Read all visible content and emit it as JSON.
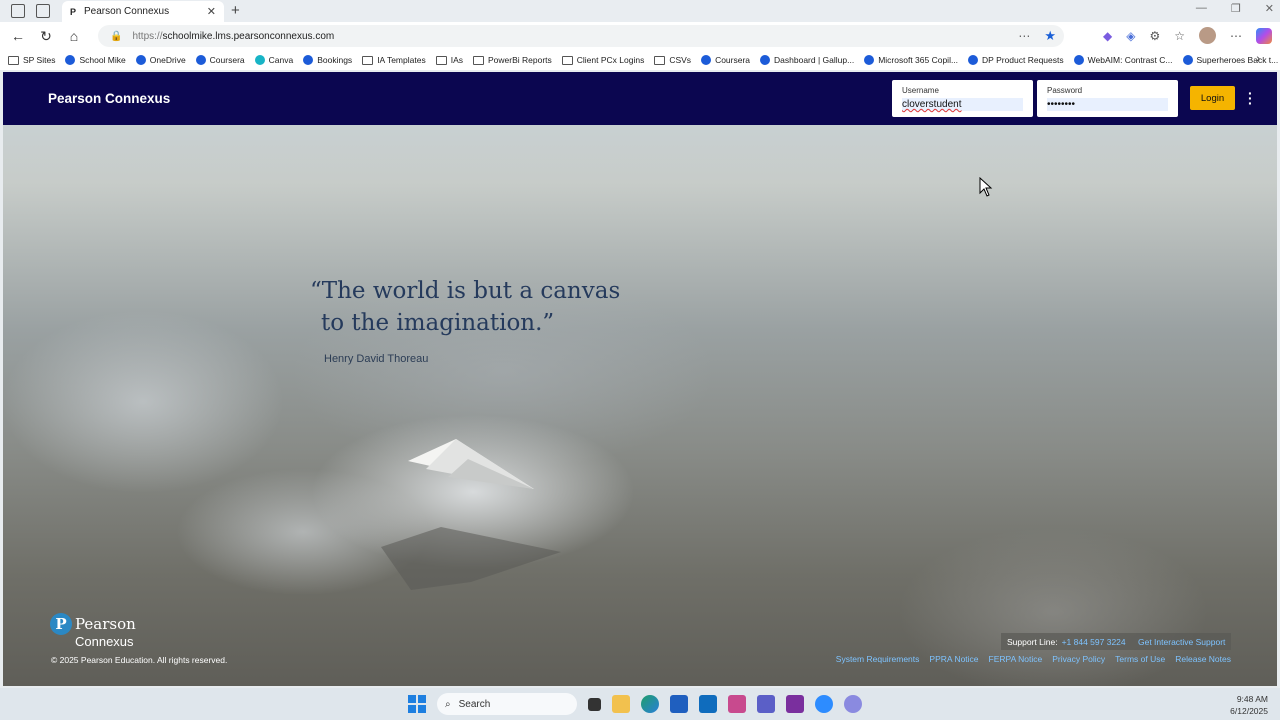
{
  "browser": {
    "tab_title": "Pearson Connexus",
    "url_protocol": "https://",
    "url_host": "schoolmike.lms.pearsonconnexus.com",
    "bookmarks": [
      {
        "label": "SP Sites",
        "icon": "folder-icon"
      },
      {
        "label": "School Mike",
        "icon": "pearson-icon"
      },
      {
        "label": "OneDrive",
        "icon": "cloud-icon"
      },
      {
        "label": "Coursera",
        "icon": "coursera-icon"
      },
      {
        "label": "Canva",
        "icon": "canva-icon"
      },
      {
        "label": "Bookings",
        "icon": "bookings-icon"
      },
      {
        "label": "IA Templates",
        "icon": "folder-icon"
      },
      {
        "label": "IAs",
        "icon": "folder-icon"
      },
      {
        "label": "PowerBi Reports",
        "icon": "folder-icon"
      },
      {
        "label": "Client PCx Logins",
        "icon": "folder-icon"
      },
      {
        "label": "CSVs",
        "icon": "folder-icon"
      },
      {
        "label": "Coursera",
        "icon": "coursera-icon"
      },
      {
        "label": "Dashboard | Gallup...",
        "icon": "gallup-icon"
      },
      {
        "label": "Microsoft 365 Copil...",
        "icon": "copilot-icon"
      },
      {
        "label": "DP Product Requests",
        "icon": "jira-icon"
      },
      {
        "label": "WebAIM: Contrast C...",
        "icon": "webaim-icon"
      },
      {
        "label": "Superheroes Back t...",
        "icon": "powerpoint-icon"
      }
    ]
  },
  "header": {
    "brand": "Pearson Connexus",
    "username_label": "Username",
    "username_value": "cloverstudent",
    "password_label": "Password",
    "password_value": "••••••••",
    "login_label": "Login"
  },
  "hero": {
    "quote_line": "“The world is but a canvas to the imagination.”",
    "author": "Henry David Thoreau"
  },
  "footer": {
    "logo_pearson": "Pearson",
    "logo_connexus": "Connexus",
    "copyright": "© 2025 Pearson Education. All rights reserved.",
    "support_label": "Support Line:",
    "support_phone": "+1 844 597 3224",
    "interactive_support": "Get Interactive Support",
    "links": [
      "System Requirements",
      "PPRA Notice",
      "FERPA Notice",
      "Privacy Policy",
      "Terms of Use",
      "Release Notes"
    ]
  },
  "taskbar": {
    "search_placeholder": "Search",
    "time": "9:48 AM",
    "date": "6/12/2025"
  },
  "colors": {
    "header_bg": "#0b0650",
    "login_button": "#f5b400",
    "link": "#7ec3ff",
    "quote_text": "#253a5c"
  }
}
